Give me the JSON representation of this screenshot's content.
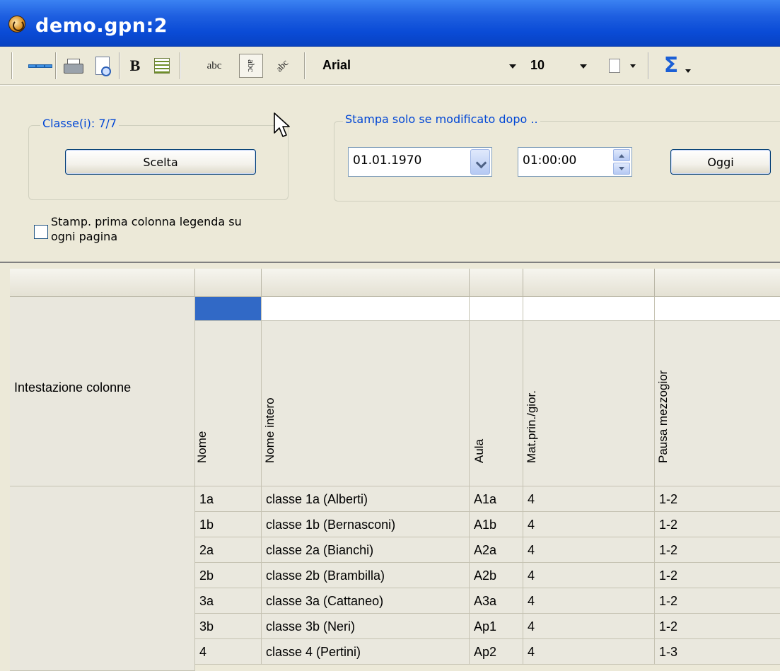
{
  "window": {
    "title": "demo.gpn:2",
    "app_icon": "untis-clock-icon"
  },
  "toolbar": {
    "font_name": "Arial",
    "font_size": "10",
    "buttons": [
      "rows-layout-icon",
      "printer-icon",
      "print-preview-icon",
      "bold-icon",
      "wrap-text-icon",
      "text-horizontal-icon",
      "text-vertical-icon",
      "text-diagonal-icon",
      "page-format-icon",
      "sum-icon"
    ]
  },
  "options": {
    "class_group_label": "Classe(i): 7/7",
    "select_button": "Scelta",
    "modified_group_label": "Stampa solo se modificato dopo ..",
    "date_value": "01.01.1970",
    "time_value": "01:00:00",
    "today_button": "Oggi",
    "legend_checkbox_label_line1": "Stamp. prima colonna legenda su",
    "legend_checkbox_label_line2": "ogni pagina",
    "legend_checkbox_checked": false
  },
  "grid": {
    "row_header_label": "Intestazione colonne",
    "columns": [
      "Nome",
      "Nome intero",
      "Aula",
      "Mat.prin./gior.",
      "Pausa mezzogior"
    ],
    "rows": [
      [
        "1a",
        "classe 1a (Alberti)",
        "A1a",
        "4",
        "1-2"
      ],
      [
        "1b",
        "classe 1b (Bernasconi)",
        "A1b",
        "4",
        "1-2"
      ],
      [
        "2a",
        "classe 2a (Bianchi)",
        "A2a",
        "4",
        "1-2"
      ],
      [
        "2b",
        "classe 2b (Brambilla)",
        "A2b",
        "4",
        "1-2"
      ],
      [
        "3a",
        "classe 3a (Cattaneo)",
        "A3a",
        "4",
        "1-2"
      ],
      [
        "3b",
        "classe 3b (Neri)",
        "Ap1",
        "4",
        "1-2"
      ],
      [
        "4",
        "classe 4 (Pertini)",
        "Ap2",
        "4",
        "1-3"
      ]
    ],
    "selected_color": "#3169c6"
  }
}
